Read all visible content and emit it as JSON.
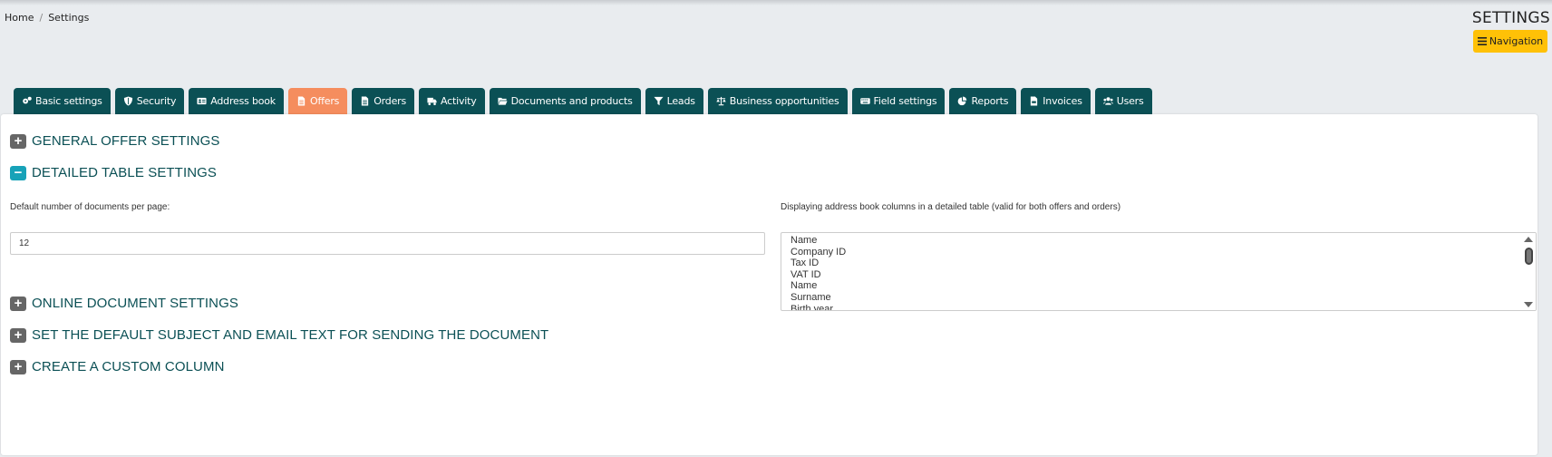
{
  "breadcrumb": {
    "home": "Home",
    "separator": "/",
    "current": "Settings"
  },
  "header": {
    "title": "SETTINGS",
    "nav_button": "Navigation"
  },
  "tabs": [
    {
      "label": "Basic settings",
      "icon": "gears-icon"
    },
    {
      "label": "Security",
      "icon": "shield-icon"
    },
    {
      "label": "Address book",
      "icon": "address-card-icon"
    },
    {
      "label": "Offers",
      "icon": "file-icon",
      "active": true
    },
    {
      "label": "Orders",
      "icon": "file-icon"
    },
    {
      "label": "Activity",
      "icon": "truck-icon"
    },
    {
      "label": "Documents and products",
      "icon": "folder-open-icon"
    },
    {
      "label": "Leads",
      "icon": "funnel-icon"
    },
    {
      "label": "Business opportunities",
      "icon": "scale-icon"
    },
    {
      "label": "Field settings",
      "icon": "keyboard-icon"
    },
    {
      "label": "Reports",
      "icon": "pie-chart-icon"
    },
    {
      "label": "Invoices",
      "icon": "file-invoice-icon"
    },
    {
      "label": "Users",
      "icon": "users-icon"
    }
  ],
  "sections": {
    "general": "GENERAL OFFER SETTINGS",
    "detailed": "DETAILED TABLE SETTINGS",
    "online": "ONLINE DOCUMENT SETTINGS",
    "email": "SET THE DEFAULT SUBJECT AND EMAIL TEXT FOR SENDING THE DOCUMENT",
    "custom": "CREATE A CUSTOM COLUMN"
  },
  "detailed": {
    "per_page_label": "Default number of documents per page:",
    "per_page_value": "12",
    "columns_label": "Displaying address book columns in a detailed table (valid for both offers and orders)",
    "columns_options": [
      "Name",
      "Company ID",
      "Tax ID",
      "VAT ID",
      "Name",
      "Surname",
      "Birth year"
    ]
  },
  "colors": {
    "tab_bg": "#0b5055",
    "tab_active_bg": "#f58d5e",
    "accent_yellow": "#ffc107",
    "section_text": "#0b5055",
    "toggle_open": "#17a2b8",
    "toggle_closed": "#666666"
  }
}
